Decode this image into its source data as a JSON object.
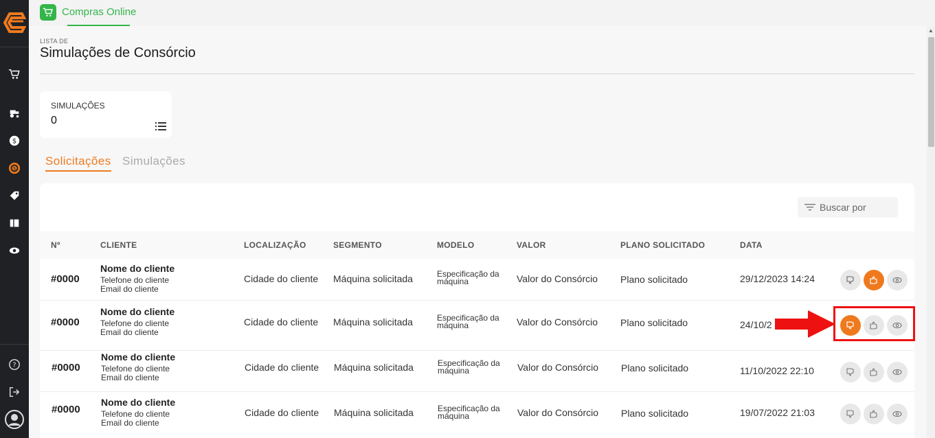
{
  "app": {
    "name": "Compras Online"
  },
  "page": {
    "eyebrow": "LISTA DE",
    "title": "Simulações de Consórcio"
  },
  "stats": {
    "label": "SIMULAÇÕES",
    "value": "0"
  },
  "tabs": [
    {
      "label": "Solicitações",
      "active": true
    },
    {
      "label": "Simulações",
      "active": false
    }
  ],
  "search": {
    "placeholder": "Buscar por"
  },
  "columns": [
    "Nº",
    "CLIENTE",
    "LOCALIZAÇÃO",
    "SEGMENTO",
    "MODELO",
    "VALOR",
    "PLANO SOLICITADO",
    "DATA"
  ],
  "rows": [
    {
      "num": "#0000",
      "name": "Nome do cliente",
      "phone": "Telefone do cliente",
      "email": "Email do cliente",
      "location": "Cidade do cliente",
      "segment": "Máquina solicitada",
      "model": "Especificação da máquina",
      "value": "Valor do Consórcio",
      "plan": "Plano solicitado",
      "date": "29/12/2023 14:24",
      "active_action": "approve"
    },
    {
      "num": "#0000",
      "name": "Nome do cliente",
      "phone": "Telefone do cliente",
      "email": "Email do cliente",
      "location": "Cidade do cliente",
      "segment": "Máquina solicitada",
      "model": "Especificação da máquina",
      "value": "Valor do Consórcio",
      "plan": "Plano solicitado",
      "date": "24/10/2",
      "active_action": "reject"
    },
    {
      "num": "#0000",
      "name": "Nome do cliente",
      "phone": "Telefone do cliente",
      "email": "Email do cliente",
      "location": "Cidade do cliente",
      "segment": "Máquina solicitada",
      "model": "Especificação da máquina",
      "value": "Valor do Consórcio",
      "plan": "Plano solicitado",
      "date": "11/10/2022 22:10",
      "active_action": "none"
    },
    {
      "num": "#0000",
      "name": "Nome do cliente",
      "phone": "Telefone do cliente",
      "email": "Email do cliente",
      "location": "Cidade do cliente",
      "segment": "Máquina solicitada",
      "model": "Especificação da máquina",
      "value": "Valor do Consórcio",
      "plan": "Plano solicitado",
      "date": "19/07/2022 21:03",
      "active_action": "none"
    }
  ],
  "sidebar_icons": [
    "cart-icon",
    "tractor-icon",
    "dollar-icon",
    "consortium-icon",
    "tag-icon",
    "ticket-icon",
    "eye-icon",
    "help-icon",
    "logout-icon",
    "user-avatar-icon"
  ],
  "colors": {
    "accent": "#ef7a1e",
    "brand_green": "#34b54a",
    "sidebar": "#1f2124",
    "highlight": "#ee1111"
  }
}
